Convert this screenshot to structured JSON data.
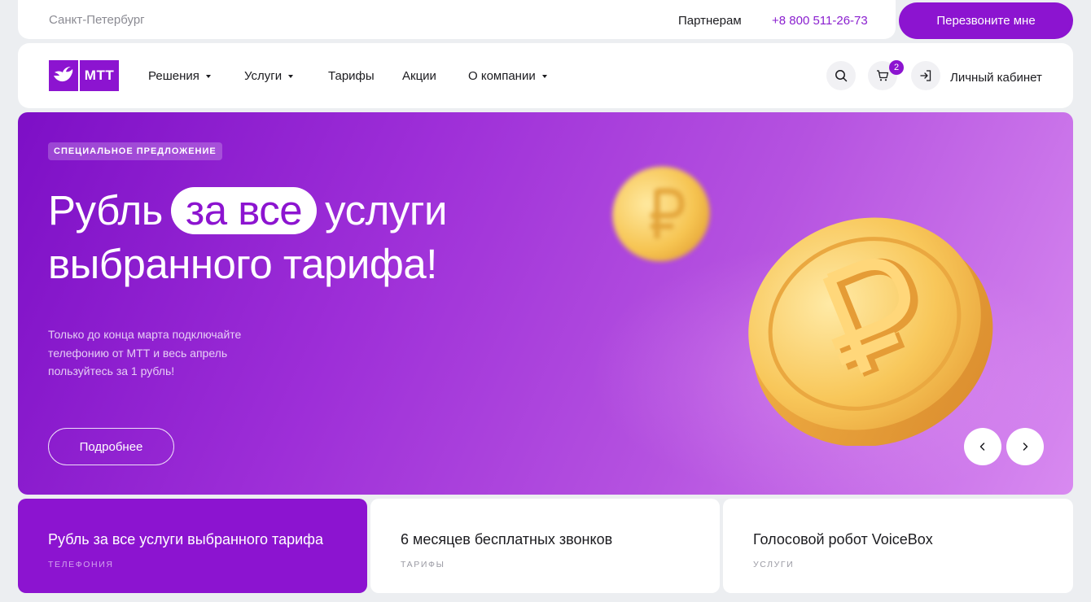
{
  "topbar": {
    "city": "Санкт-Петербург",
    "partners": "Партнерам",
    "phone": "+8 800 511-26-73",
    "callback_label": "Перезвоните мне"
  },
  "navbar": {
    "logo_text": "МТТ",
    "items": [
      {
        "label": "Решения",
        "dropdown": true
      },
      {
        "label": "Услуги",
        "dropdown": true
      },
      {
        "label": "Тарифы",
        "dropdown": false
      },
      {
        "label": "Акции",
        "dropdown": false
      },
      {
        "label": "О компании",
        "dropdown": true
      }
    ],
    "cart_count": "2",
    "cabinet_label": "Личный кабинет",
    "icons": [
      "search-icon",
      "cart-icon",
      "login-icon"
    ]
  },
  "hero": {
    "tag": "СПЕЦИАЛЬНОЕ ПРЕДЛОЖЕНИЕ",
    "title_part1": "Рубль",
    "title_highlight": "за все",
    "title_part2": "услуги",
    "title_line2": "выбранного тарифа!",
    "description": "Только до конца марта подключайте телефонию от МТТ и весь апрель пользуйтесь за 1 рубль!",
    "button_label": "Подробнее",
    "accent_color": "#8c14d0"
  },
  "cards": [
    {
      "title": "Рубль за все услуги выбранного тарифа",
      "category": "ТЕЛЕФОНИЯ",
      "active": true
    },
    {
      "title": "6 месяцев бесплатных звонков",
      "category": "ТАРИФЫ",
      "active": false
    },
    {
      "title": "Голосовой робот VoiceBox",
      "category": "УСЛУГИ",
      "active": false
    }
  ]
}
